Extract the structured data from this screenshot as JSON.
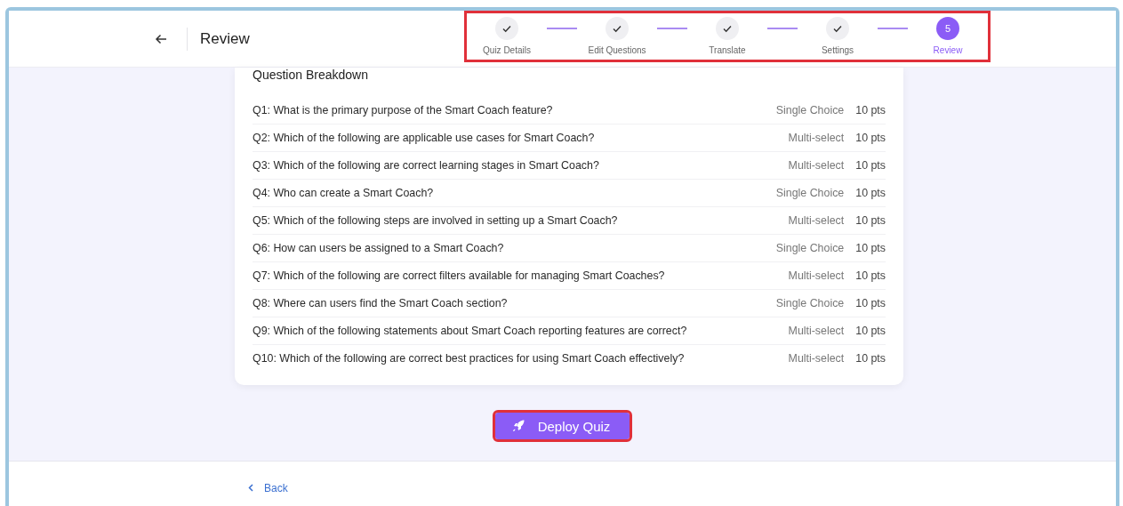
{
  "header": {
    "title": "Review"
  },
  "stepper": {
    "highlighted": true,
    "steps": [
      {
        "label": "Quiz Details",
        "completed": true,
        "selected": false
      },
      {
        "label": "Edit Questions",
        "completed": true,
        "selected": false
      },
      {
        "label": "Translate",
        "completed": true,
        "selected": false
      },
      {
        "label": "Settings",
        "completed": true,
        "selected": false
      },
      {
        "label": "Review",
        "completed": false,
        "selected": true,
        "number": "5"
      }
    ]
  },
  "breakdown": {
    "title": "Question Breakdown",
    "questions": [
      {
        "text": "Q1: What is the primary purpose of the Smart Coach feature?",
        "type": "Single Choice",
        "points": "10 pts"
      },
      {
        "text": "Q2: Which of the following are applicable use cases for Smart Coach?",
        "type": "Multi-select",
        "points": "10 pts"
      },
      {
        "text": "Q3: Which of the following are correct learning stages in Smart Coach?",
        "type": "Multi-select",
        "points": "10 pts"
      },
      {
        "text": "Q4: Who can create a Smart Coach?",
        "type": "Single Choice",
        "points": "10 pts"
      },
      {
        "text": "Q5: Which of the following steps are involved in setting up a Smart Coach?",
        "type": "Multi-select",
        "points": "10 pts"
      },
      {
        "text": "Q6: How can users be assigned to a Smart Coach?",
        "type": "Single Choice",
        "points": "10 pts"
      },
      {
        "text": "Q7: Which of the following are correct filters available for managing Smart Coaches?",
        "type": "Multi-select",
        "points": "10 pts"
      },
      {
        "text": "Q8: Where can users find the Smart Coach section?",
        "type": "Single Choice",
        "points": "10 pts"
      },
      {
        "text": "Q9: Which of the following statements about Smart Coach reporting features are correct?",
        "type": "Multi-select",
        "points": "10 pts"
      },
      {
        "text": "Q10: Which of the following are correct best practices for using Smart Coach effectively?",
        "type": "Multi-select",
        "points": "10 pts"
      }
    ]
  },
  "deploy_button": {
    "label": "Deploy Quiz",
    "highlighted": true
  },
  "back_link": {
    "label": "Back"
  }
}
